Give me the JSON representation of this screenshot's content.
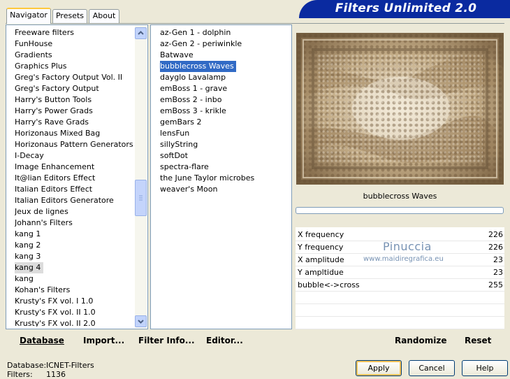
{
  "title": "Filters Unlimited 2.0",
  "tabs": [
    "Navigator",
    "Presets",
    "About"
  ],
  "categories": [
    "Freeware filters",
    "FunHouse",
    "Gradients",
    "Graphics Plus",
    "Greg's Factory Output Vol. II",
    "Greg's Factory Output",
    "Harry's Button Tools",
    "Harry's Power Grads",
    "Harry's Rave Grads",
    "Horizonaus Mixed Bag",
    "Horizonaus Pattern Generators",
    "I-Decay",
    "Image Enhancement",
    "It@lian Editors Effect",
    "Italian Editors Effect",
    "Italian Editors Generatore",
    "Jeux de lignes",
    "Johann's Filters",
    "kang 1",
    "kang 2",
    "kang 3",
    "kang 4",
    "kang",
    "Kohan's Filters",
    "Krusty's FX vol. I 1.0",
    "Krusty's FX vol. II 1.0",
    "Krusty's FX vol. II 2.0"
  ],
  "selected_category": "kang 4",
  "filters": [
    "az-Gen 1  -  dolphin",
    "az-Gen 2  -  periwinkle",
    "Batwave",
    "bubblecross Waves",
    "dayglo Lavalamp",
    "emBoss 1  -  grave",
    "emBoss 2  -  inbo",
    "emBoss 3  -  krikle",
    "gemBars 2",
    "lensFun",
    "sillyString",
    "softDot",
    "spectra-flare",
    "the June Taylor microbes",
    "weaver's Moon"
  ],
  "selected_filter": "bubblecross Waves",
  "filter_name": "bubblecross Waves",
  "params": [
    {
      "label": "X frequency",
      "value": "226"
    },
    {
      "label": "Y frequency",
      "value": "226"
    },
    {
      "label": "X amplitude",
      "value": "23"
    },
    {
      "label": "Y ampltidue",
      "value": "23"
    },
    {
      "label": "bubble<->cross",
      "value": "255"
    }
  ],
  "watermark": {
    "name": "Pinuccia",
    "site": "www.maidiregrafica.eu"
  },
  "bottom": {
    "database": "Database",
    "import": "Import...",
    "filter_info": "Filter Info...",
    "editor": "Editor...",
    "randomize": "Randomize",
    "reset": "Reset"
  },
  "status": {
    "db_label": "Database:",
    "db_value": "ICNET-Filters",
    "filters_label": "Filters:",
    "filters_value": "1136"
  },
  "buttons": {
    "apply": "Apply",
    "cancel": "Cancel",
    "help": "Help"
  }
}
